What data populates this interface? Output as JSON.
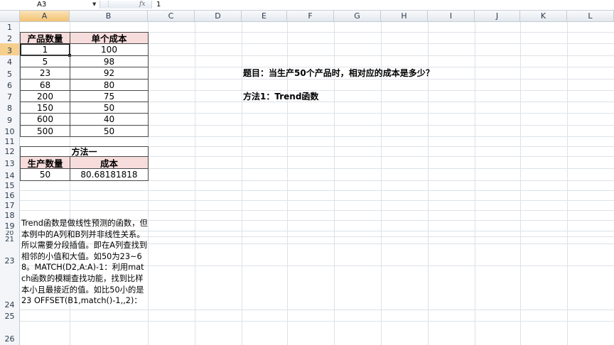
{
  "formula_bar": {
    "name_box": "A3",
    "fx_label": "fx",
    "value": "1"
  },
  "columns": [
    "A",
    "B",
    "C",
    "D",
    "E",
    "F",
    "G",
    "H",
    "I",
    "J",
    "K",
    "L"
  ],
  "rows": [
    "1",
    "2",
    "3",
    "4",
    "5",
    "6",
    "7",
    "8",
    "9",
    "10",
    "11",
    "12",
    "13",
    "14",
    "15",
    "16",
    "17",
    "18",
    "19",
    "20",
    "21",
    "23",
    "24",
    "25",
    "26"
  ],
  "table1": {
    "headers": [
      "产品数量",
      "单个成本"
    ],
    "rows": [
      [
        "1",
        "100"
      ],
      [
        "5",
        "98"
      ],
      [
        "23",
        "92"
      ],
      [
        "68",
        "80"
      ],
      [
        "200",
        "75"
      ],
      [
        "150",
        "50"
      ],
      [
        "600",
        "40"
      ],
      [
        "500",
        "50"
      ]
    ]
  },
  "table2": {
    "title": "方法一",
    "headers": [
      "生产数量",
      "成本"
    ],
    "row": [
      "50",
      "80.68181818"
    ]
  },
  "notes": {
    "question": "题目：当生产50个产品时，相对应的成本是多少？",
    "method": "方法1：Trend函数"
  },
  "explanation": "Trend函数是做线性预测的函数，但本例中的A列和B列并非线性关系。所以需要分段插值。即在A列查找到相邻的小值和大值。如50为23~68。MATCH(D2,A:A)-1：利用match函数的模糊查找功能，找到比样本小且最接近的值。如比50小的是23 OFFSET(B1,match()-1,,2)："
}
